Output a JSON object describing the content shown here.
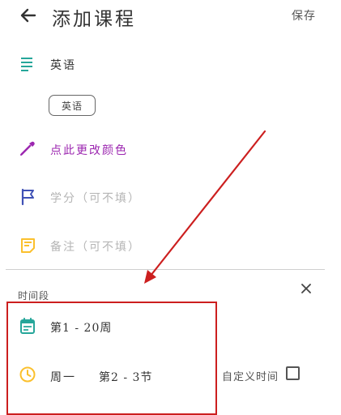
{
  "header": {
    "back_icon": "arrow-left-icon",
    "title": "添加课程",
    "save_label": "保存"
  },
  "form": {
    "course_name": {
      "icon": "notes-lines-icon",
      "value": "英语",
      "chip": "英语",
      "icon_color": "#26a69a"
    },
    "color": {
      "icon": "eyedropper-icon",
      "label": "点此更改颜色",
      "icon_color": "#9c27b0"
    },
    "credit": {
      "icon": "flag-icon",
      "placeholder": "学分（可不填）",
      "icon_color": "#3f51b5"
    },
    "note": {
      "icon": "sticky-note-icon",
      "placeholder": "备注（可不填）",
      "icon_color": "#fbc02d"
    }
  },
  "time_section": {
    "label": "时间段",
    "close_icon": "close-icon",
    "weeks": {
      "icon": "calendar-icon",
      "value": "第1 - 20周",
      "icon_color": "#26a69a"
    },
    "day_period": {
      "icon": "clock-icon",
      "day": "周一",
      "periods": "第2 - 3节",
      "icon_color": "#fbc02d"
    },
    "custom_time": {
      "label": "自定义时间",
      "checked": false
    }
  },
  "annotation": {
    "color": "#cc1f1f"
  }
}
